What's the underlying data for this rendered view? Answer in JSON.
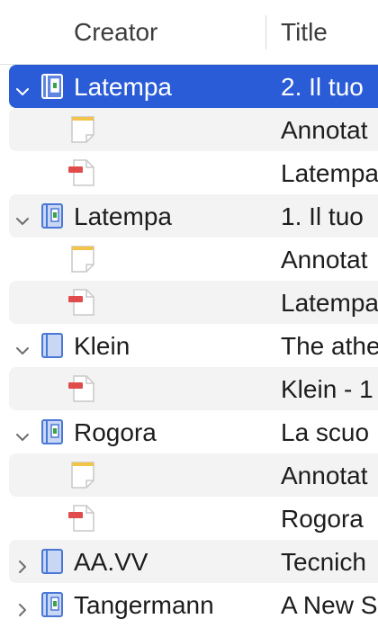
{
  "columns": {
    "creator": "Creator",
    "title": "Title"
  },
  "colors": {
    "selection": "#2b5cd7",
    "alt_row": "#f3f3f3",
    "note_accent": "#f3c34a",
    "attachment_accent": "#e04c4c",
    "book_blue": "#4a78d6"
  },
  "rows": [
    {
      "kind": "parent",
      "expanded": true,
      "selected": true,
      "alt": false,
      "icon": "book-section-icon",
      "creator": "Latempa",
      "title": "2. Il tuo"
    },
    {
      "kind": "child",
      "alt": true,
      "icon": "note-icon",
      "creator": "",
      "title": "Annotat"
    },
    {
      "kind": "child",
      "alt": false,
      "icon": "pdf-attachment-icon",
      "creator": "",
      "title": "Latempa"
    },
    {
      "kind": "parent",
      "expanded": true,
      "selected": false,
      "alt": true,
      "icon": "book-section-icon",
      "creator": "Latempa",
      "title": "1. Il tuo"
    },
    {
      "kind": "child",
      "alt": false,
      "icon": "note-icon",
      "creator": "",
      "title": "Annotat"
    },
    {
      "kind": "child",
      "alt": true,
      "icon": "pdf-attachment-icon",
      "creator": "",
      "title": "Latempa"
    },
    {
      "kind": "parent",
      "expanded": true,
      "selected": false,
      "alt": false,
      "icon": "book-icon",
      "creator": "Klein",
      "title": "The athe"
    },
    {
      "kind": "child",
      "alt": true,
      "icon": "pdf-attachment-icon",
      "creator": "",
      "title": "Klein - 1"
    },
    {
      "kind": "parent",
      "expanded": true,
      "selected": false,
      "alt": false,
      "icon": "book-section-icon",
      "creator": "Rogora",
      "title": "La scuo"
    },
    {
      "kind": "child",
      "alt": true,
      "icon": "note-icon",
      "creator": "",
      "title": "Annotat"
    },
    {
      "kind": "child",
      "alt": false,
      "icon": "pdf-attachment-icon",
      "creator": "",
      "title": "Rogora"
    },
    {
      "kind": "parent",
      "expanded": false,
      "selected": false,
      "alt": true,
      "icon": "book-icon",
      "creator": "AA.VV",
      "title": "Tecnich"
    },
    {
      "kind": "parent",
      "expanded": false,
      "selected": false,
      "alt": false,
      "icon": "book-section-icon",
      "creator": "Tangermann",
      "title": "A New S"
    }
  ]
}
